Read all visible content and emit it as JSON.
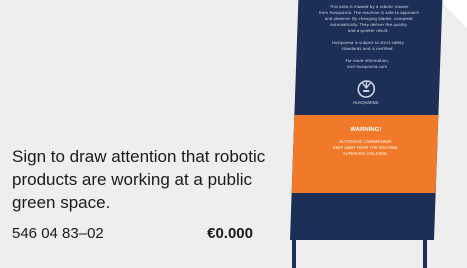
{
  "product": {
    "description": "Sign to draw attention that robotic products are working at a public green space.",
    "article_number": "546 04 83–02",
    "price": "€0.000"
  },
  "sign": {
    "info_lines": [
      "This area is mowed by a robotic mower",
      "from Husqvarna. The machine is safe to approach",
      "and observe. By changing blades, complete",
      "automatically. They deliver the quality",
      "and a quieter result.",
      "Husqvarna is subject to strict safety",
      "standards and is certified.",
      "For more information,",
      "visit husqvarna.com"
    ],
    "brand": "HUSQVARNA",
    "warning": {
      "title": "WARNING!",
      "lines": [
        "AUTOMATIC LAWNMOWER",
        "KEEP AWAY FROM THE MACHINE",
        "SUPERVISE CHILDREN"
      ]
    }
  },
  "colors": {
    "card_background": "#eeeeee",
    "sign_navy": "#1c2f56",
    "sign_orange": "#f07a2a"
  }
}
